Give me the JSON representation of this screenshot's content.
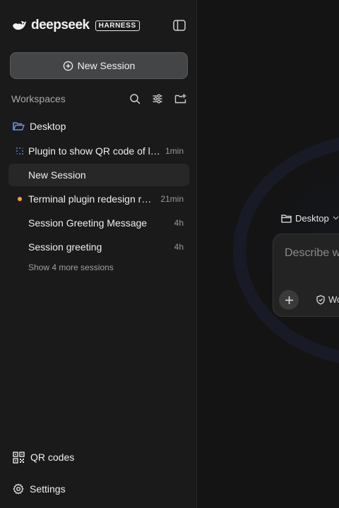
{
  "brand": {
    "name": "deepseek",
    "badge": "HARNESS"
  },
  "sidebar": {
    "new_session_label": "New Session",
    "workspaces_label": "Workspaces",
    "folder": {
      "label": "Desktop"
    },
    "sessions": [
      {
        "title": "Plugin to show QR code of l…",
        "time": "1min",
        "status": "running"
      },
      {
        "title": "New Session",
        "time": "",
        "status": "active"
      },
      {
        "title": "Terminal plugin redesign r…",
        "time": "21min",
        "status": "unread"
      },
      {
        "title": "Session Greeting Message",
        "time": "4h",
        "status": "none"
      },
      {
        "title": "Session greeting",
        "time": "4h",
        "status": "none"
      }
    ],
    "show_more_label": "Show 4 more sessions",
    "bottom": {
      "qr_label": "QR codes",
      "settings_label": "Settings"
    }
  },
  "main": {
    "directory_label": "Desktop",
    "composer_placeholder": "Describe w",
    "mode_label": "Wo"
  },
  "colors": {
    "accent_folder": "#6f8fe8",
    "unread_dot": "#f0a23a",
    "sidebar_bg": "#1a1a1a",
    "main_bg": "#141414"
  }
}
